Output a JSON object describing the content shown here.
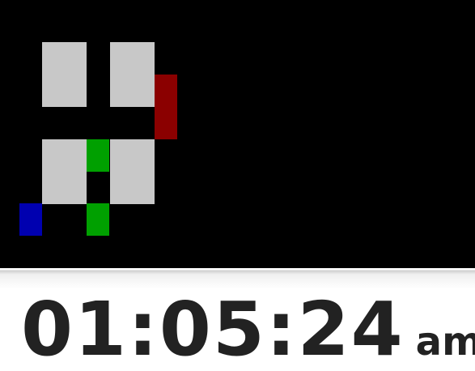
{
  "clock": {
    "time": "01:05:24",
    "period": "am"
  },
  "colors": {
    "board_background": "#000000",
    "wall": "#c8c8c8",
    "red_piece": "#8b0000",
    "green_piece": "#00a000",
    "blue_piece": "#0000b0",
    "clock_text": "#222222"
  }
}
